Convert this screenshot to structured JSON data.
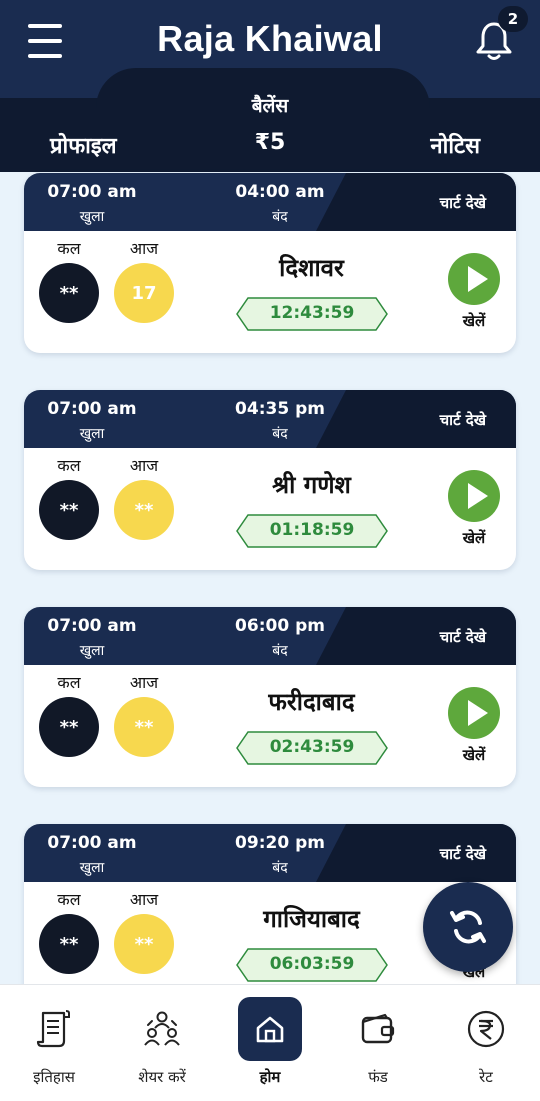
{
  "header": {
    "title": "Raja Khaiwal",
    "notification_count": "2",
    "balance_label": "बैलेंस",
    "balance_value": "₹5",
    "profile_label": "प्रोफाइल",
    "notice_label": "नोटिस"
  },
  "card_labels": {
    "open": "खुला",
    "close": "बंद",
    "chart": "चार्ट देखे",
    "yesterday": "कल",
    "today": "आज",
    "play": "खेलें"
  },
  "games": [
    {
      "name": "दिशावर",
      "open_time": "07:00 am",
      "close_time": "04:00 am",
      "yesterday_result": "**",
      "today_result": "17",
      "countdown": "12:43:59"
    },
    {
      "name": "श्री गणेश",
      "open_time": "07:00 am",
      "close_time": "04:35 pm",
      "yesterday_result": "**",
      "today_result": "**",
      "countdown": "01:18:59"
    },
    {
      "name": "फरीदाबाद",
      "open_time": "07:00 am",
      "close_time": "06:00 pm",
      "yesterday_result": "**",
      "today_result": "**",
      "countdown": "02:43:59"
    },
    {
      "name": "गाजियाबाद",
      "open_time": "07:00 am",
      "close_time": "09:20 pm",
      "yesterday_result": "**",
      "today_result": "**",
      "countdown": "06:03:59"
    }
  ],
  "bottom_nav": [
    {
      "label": "इतिहास",
      "icon": "history-scroll-icon"
    },
    {
      "label": "शेयर करें",
      "icon": "share-users-icon"
    },
    {
      "label": "होम",
      "icon": "home-icon",
      "active": true
    },
    {
      "label": "फंड",
      "icon": "wallet-icon"
    },
    {
      "label": "रेट",
      "icon": "rupee-icon"
    }
  ],
  "colors": {
    "header_bg": "#1a2c50",
    "header_dark": "#0f1a30",
    "yellow_ball": "#f7d84e",
    "play_green": "#5ea83c",
    "timer_green": "#2e8b3d"
  }
}
